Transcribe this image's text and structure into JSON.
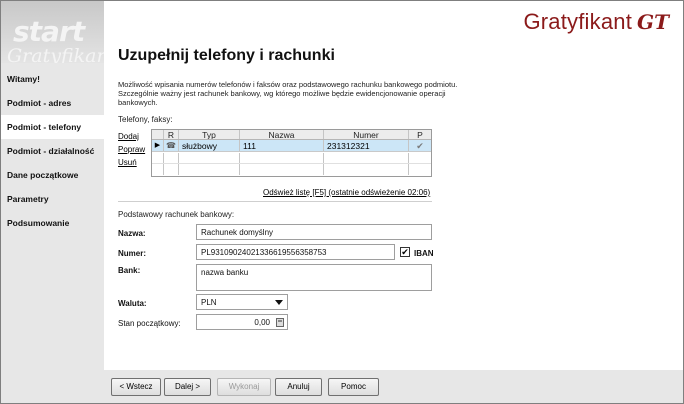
{
  "app": {
    "brand": "Gratyfikant",
    "brand_mark": "GT",
    "sidebar_watermark_1": "start",
    "sidebar_watermark_2": "Gratyfikant"
  },
  "sidebar": {
    "items": [
      {
        "label": "Witamy!",
        "active": false
      },
      {
        "label": "Podmiot - adres",
        "active": false
      },
      {
        "label": "Podmiot - telefony",
        "active": true
      },
      {
        "label": "Podmiot - działalność",
        "active": false
      },
      {
        "label": "Dane początkowe",
        "active": false
      },
      {
        "label": "Parametry",
        "active": false
      },
      {
        "label": "Podsumowanie",
        "active": false
      }
    ]
  },
  "page": {
    "title": "Uzupełnij telefony i rachunki",
    "description": "Możliwość wpisania numerów telefonów i faksów oraz podstawowego rachunku bankowego podmiotu. Szczególnie ważny jest rachunek bankowy, wg którego możliwe będzie ewidencjonowanie operacji bankowych."
  },
  "phones": {
    "section_label": "Telefony, faksy:",
    "actions": [
      "Dodaj",
      "Popraw",
      "Usuń"
    ],
    "columns": [
      "",
      "R",
      "Typ",
      "Nazwa",
      "Numer",
      "P"
    ],
    "rows": [
      {
        "indicator": "▶",
        "r_icon": "phone-icon",
        "typ": "służbowy",
        "nazwa": "111",
        "numer": "231312321",
        "p": "✔"
      }
    ],
    "refresh_link": "Odśwież listę [F5] (ostatnie odświeżenie 02:06)"
  },
  "bank": {
    "section_label": "Podstawowy rachunek bankowy:",
    "nazwa_label": "Nazwa:",
    "nazwa_value": "Rachunek domyślny",
    "numer_label": "Numer:",
    "numer_value": "PL93109024021336619556358753",
    "iban_label": "IBAN",
    "iban_checked": true,
    "bank_label": "Bank:",
    "bank_value": "nazwa banku",
    "waluta_label": "Waluta:",
    "waluta_value": "PLN",
    "stan_label": "Stan początkowy:",
    "stan_value": "0,00"
  },
  "buttons": {
    "back": "< Wstecz",
    "next": "Dalej >",
    "execute": "Wykonaj",
    "cancel": "Anuluj",
    "help": "Pomoc"
  }
}
